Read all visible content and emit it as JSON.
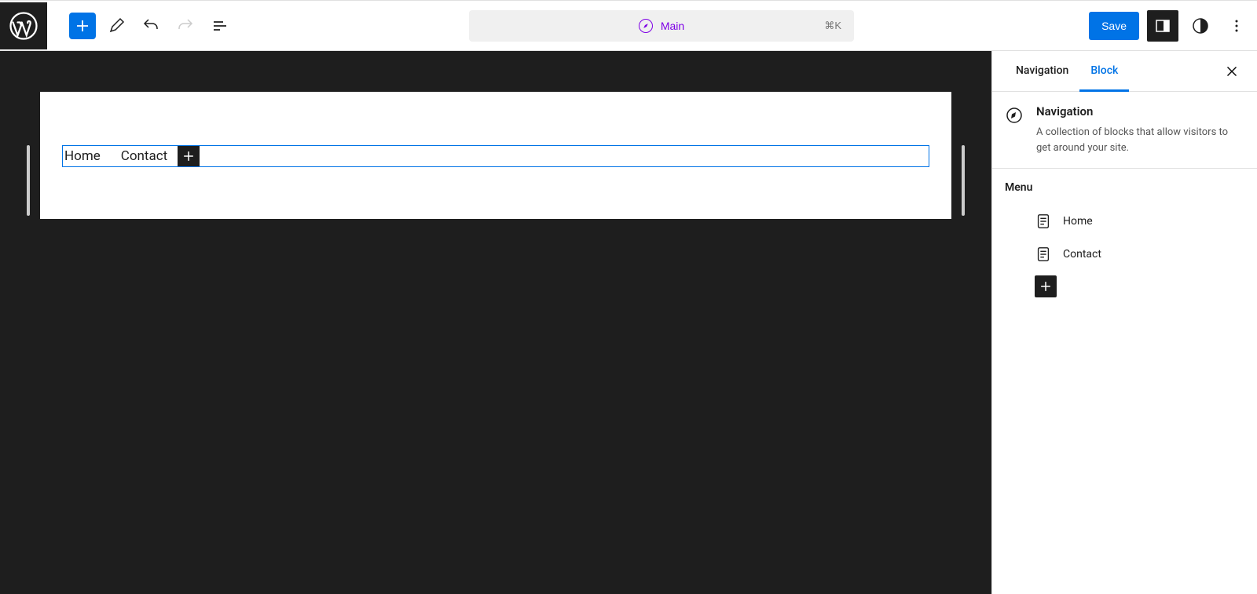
{
  "toolbar": {
    "template_label": "Main",
    "shortcut": "⌘K",
    "save_label": "Save"
  },
  "canvas": {
    "nav_items": [
      "Home",
      "Contact"
    ]
  },
  "sidebar": {
    "tabs": {
      "navigation": "Navigation",
      "block": "Block"
    },
    "block_title": "Navigation",
    "block_description": "A collection of blocks that allow visitors to get around your site.",
    "menu_heading": "Menu",
    "menu_items": [
      "Home",
      "Contact"
    ]
  }
}
